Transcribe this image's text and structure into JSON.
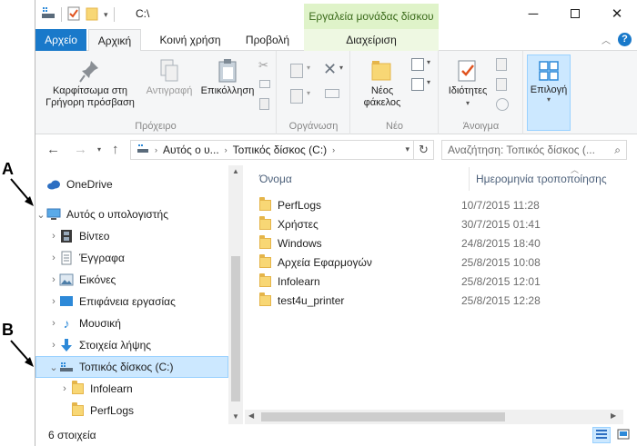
{
  "window": {
    "path": "C:\\",
    "context_title": "Εργαλεία μονάδας δίσκου"
  },
  "tabs": [
    {
      "label": "Αρχείο"
    },
    {
      "label": "Αρχική"
    },
    {
      "label": "Κοινή χρήση"
    },
    {
      "label": "Προβολή"
    },
    {
      "label": "Διαχείριση"
    }
  ],
  "ribbon": {
    "pin_label": "Καρφίτσωμα στη Γρήγορη πρόσβαση",
    "copy_label": "Αντιγραφή",
    "paste_label": "Επικόλληση",
    "clipboard_group": "Πρόχειρο",
    "organize_group": "Οργάνωση",
    "new_folder_label": "Νέος φάκελος",
    "new_group": "Νέο",
    "properties_label": "Ιδιότητες",
    "open_group": "Άνοιγμα",
    "select_label": "Επιλογή"
  },
  "address": {
    "crumbs": [
      "Αυτός ο υ...",
      "Τοπικός δίσκος (C:)"
    ],
    "search_placeholder": "Αναζήτηση: Τοπικός δίσκος (..."
  },
  "nav": {
    "items": [
      {
        "label": "OneDrive"
      },
      {
        "label": "Αυτός ο υπολογιστής"
      },
      {
        "label": "Βίντεο"
      },
      {
        "label": "Έγγραφα"
      },
      {
        "label": "Εικόνες"
      },
      {
        "label": "Επιφάνεια εργασίας"
      },
      {
        "label": "Μουσική"
      },
      {
        "label": "Στοιχεία λήψης"
      },
      {
        "label": "Τοπικός δίσκος (C:)"
      },
      {
        "label": "Infolearn"
      },
      {
        "label": "PerfLogs"
      }
    ]
  },
  "columns": {
    "name": "Όνομα",
    "date": "Ημερομηνία τροποποίησης"
  },
  "files": [
    {
      "name": "PerfLogs",
      "date": "10/7/2015 11:28"
    },
    {
      "name": "Χρήστες",
      "date": "30/7/2015 01:41"
    },
    {
      "name": "Windows",
      "date": "24/8/2015 18:40"
    },
    {
      "name": "Αρχεία Εφαρμογών",
      "date": "25/8/2015 10:08"
    },
    {
      "name": "Infolearn",
      "date": "25/8/2015 12:01"
    },
    {
      "name": "test4u_printer",
      "date": "25/8/2015 12:28"
    }
  ],
  "status": {
    "count": "6 στοιχεία"
  },
  "annotations": {
    "a": "A",
    "b": "B"
  },
  "colors": {
    "file_tab": "#1979ca",
    "context_tab": "#dff3c9",
    "selection": "#cce8ff",
    "folder": "#f8d775"
  }
}
